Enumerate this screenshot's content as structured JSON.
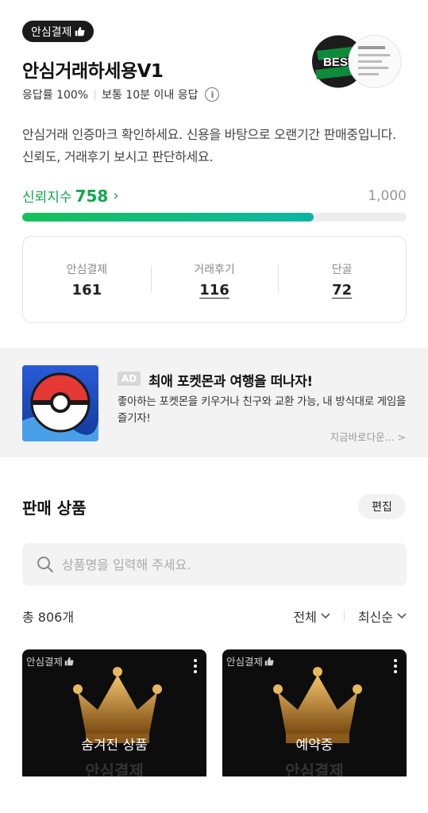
{
  "header": {
    "safe_badge": "안심결제",
    "shop_name": "안심거래하세용V1",
    "response_rate": "응답률 100%",
    "response_time": "보통 10분 이내 응답",
    "description": "안심거래 인증마크 확인하세요. 신용을 바탕으로 오랜기간 판매중입니다. 신뢰도, 거래후기 보시고 판단하세요."
  },
  "trust": {
    "label": "신뢰지수",
    "value": "758",
    "max": "1,000",
    "fraction": 0.758
  },
  "stats": [
    {
      "label": "안심결제",
      "value": "161"
    },
    {
      "label": "거래후기",
      "value": "116"
    },
    {
      "label": "단골",
      "value": "72"
    }
  ],
  "ad": {
    "tag": "AD",
    "title": "최애 포켓몬과 여행을 떠나자!",
    "description": "좋아하는 포켓몬을 키우거나 친구와 교환 가능, 내 방식대로 게임을 즐기자!",
    "cta": "지금바로다운... >"
  },
  "products": {
    "title": "판매 상품",
    "edit_label": "편집",
    "search_placeholder": "상품명을 입력해 주세요.",
    "total": "총 806개",
    "filter_label": "전체",
    "sort_label": "최신순",
    "items": [
      {
        "tag": "안심결제",
        "label": "숨겨진 상품",
        "watermark": "안심결제"
      },
      {
        "tag": "안심결제",
        "label": "예약중",
        "watermark": "안심결제"
      }
    ]
  },
  "colors": {
    "trust_green": "#11a84a",
    "badge_bg": "#1b1b1b"
  }
}
